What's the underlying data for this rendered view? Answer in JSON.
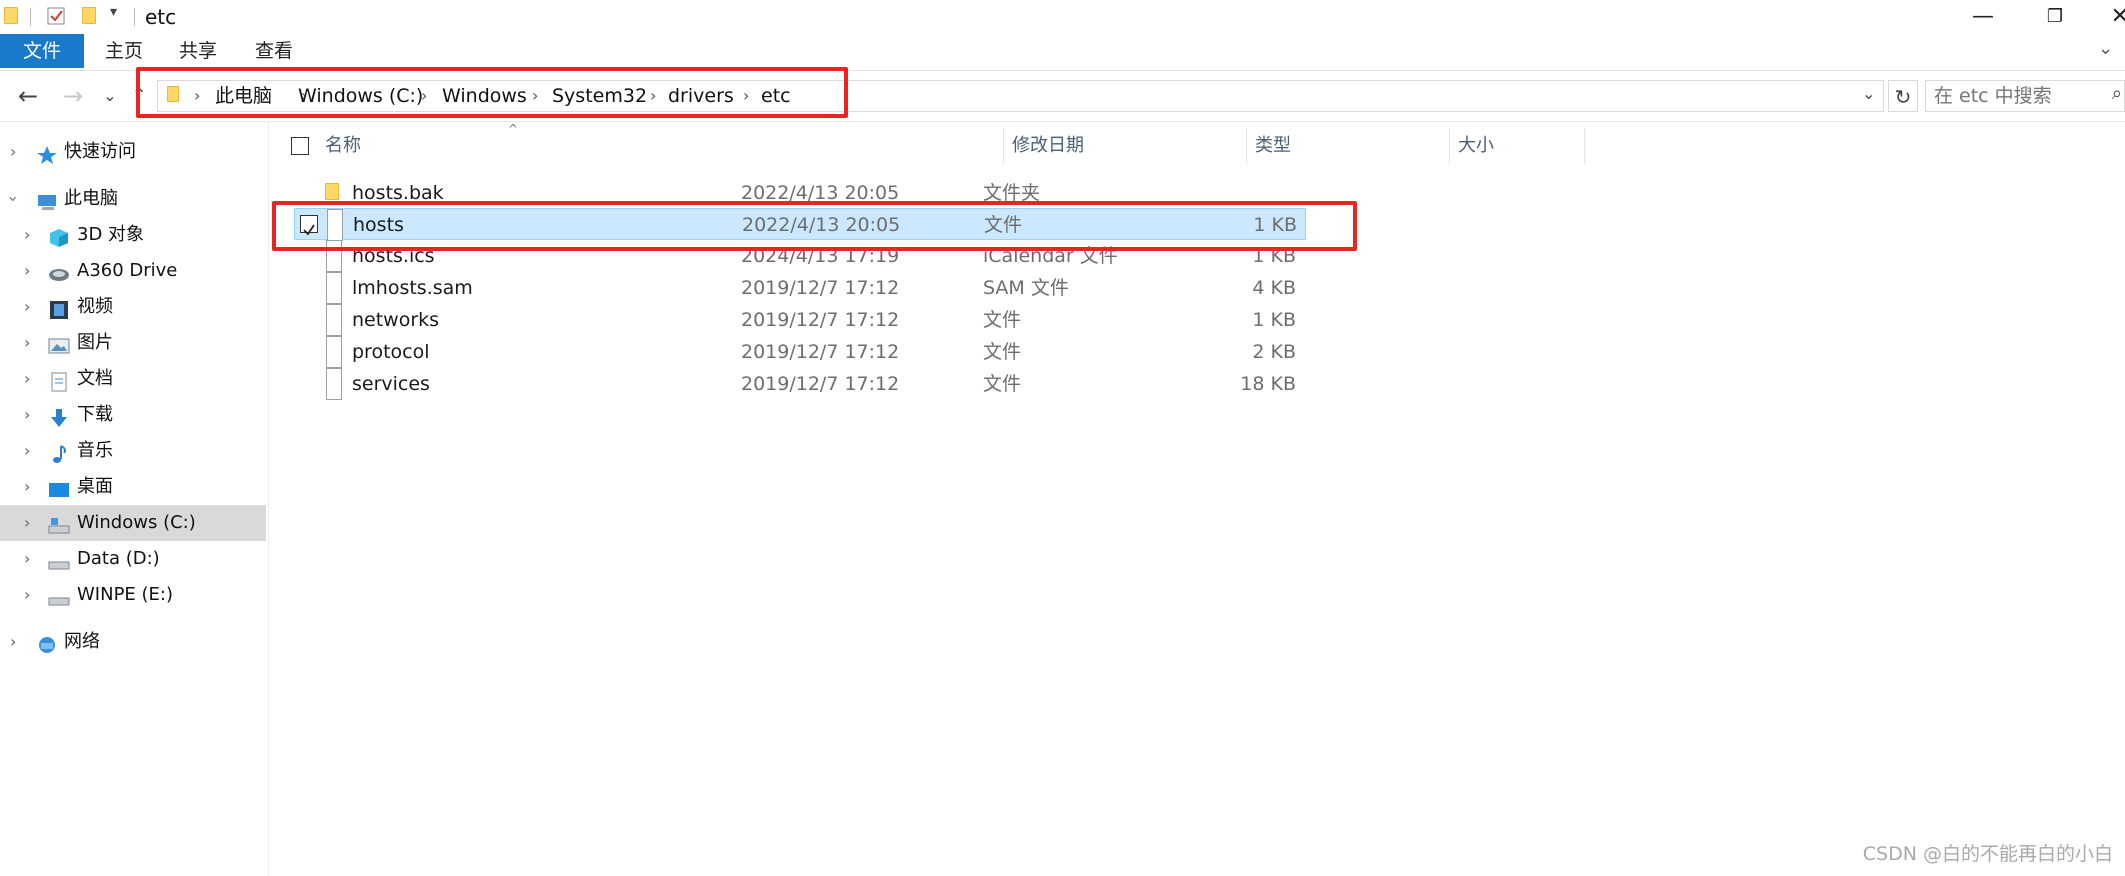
{
  "window": {
    "title": "etc"
  },
  "ribbon": {
    "tabs": [
      "文件",
      "主页",
      "共享",
      "查看"
    ]
  },
  "address": {
    "crumbs": [
      "此电脑",
      "Windows (C:)",
      "Windows",
      "System32",
      "drivers",
      "etc"
    ]
  },
  "search": {
    "placeholder": "在 etc 中搜索"
  },
  "sidebar": {
    "items": [
      {
        "label": "快速访问",
        "icon": "star-icon"
      },
      {
        "label": "此电脑",
        "icon": "computer-icon"
      },
      {
        "label": "3D 对象",
        "icon": "cube-icon"
      },
      {
        "label": "A360 Drive",
        "icon": "cloud-drive-icon"
      },
      {
        "label": "视频",
        "icon": "video-icon"
      },
      {
        "label": "图片",
        "icon": "picture-icon"
      },
      {
        "label": "文档",
        "icon": "document-icon"
      },
      {
        "label": "下载",
        "icon": "download-icon"
      },
      {
        "label": "音乐",
        "icon": "music-icon"
      },
      {
        "label": "桌面",
        "icon": "desktop-icon"
      },
      {
        "label": "Windows (C:)",
        "icon": "drive-icon"
      },
      {
        "label": "Data (D:)",
        "icon": "drive-icon"
      },
      {
        "label": "WINPE (E:)",
        "icon": "drive-icon"
      },
      {
        "label": "网络",
        "icon": "network-icon"
      }
    ]
  },
  "columns": {
    "name": "名称",
    "date": "修改日期",
    "type": "类型",
    "size": "大小"
  },
  "files": [
    {
      "name": "hosts.bak",
      "date": "2022/4/13 20:05",
      "type": "文件夹",
      "size": ""
    },
    {
      "name": "hosts",
      "date": "2022/4/13 20:05",
      "type": "文件",
      "size": "1 KB"
    },
    {
      "name": "hosts.ics",
      "date": "2024/4/13 17:19",
      "type": "iCalendar 文件",
      "size": "1 KB"
    },
    {
      "name": "lmhosts.sam",
      "date": "2019/12/7 17:12",
      "type": "SAM 文件",
      "size": "4 KB"
    },
    {
      "name": "networks",
      "date": "2019/12/7 17:12",
      "type": "文件",
      "size": "1 KB"
    },
    {
      "name": "protocol",
      "date": "2019/12/7 17:12",
      "type": "文件",
      "size": "2 KB"
    },
    {
      "name": "services",
      "date": "2019/12/7 17:12",
      "type": "文件",
      "size": "18 KB"
    }
  ],
  "watermark": "CSDN @白的不能再白的小白",
  "colors": {
    "accent": "#1979ca",
    "selection": "#cce8ff",
    "highlight": "#e8261f"
  }
}
